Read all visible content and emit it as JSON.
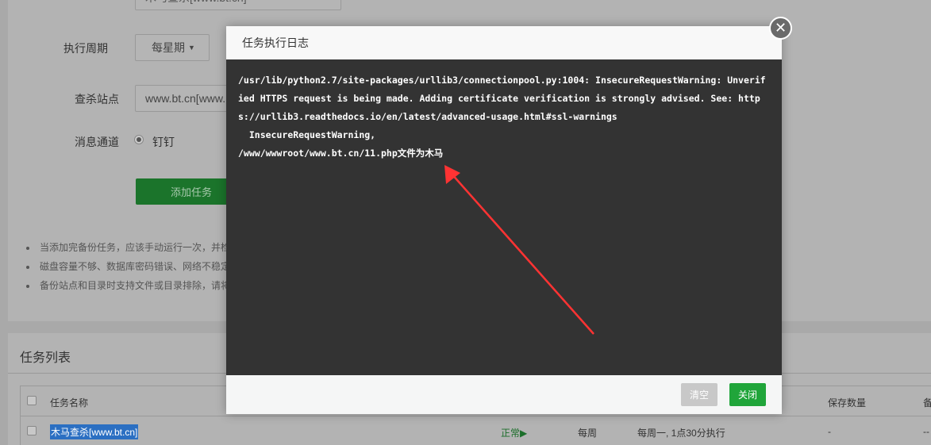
{
  "form": {
    "task_name_label": "任务名称",
    "task_name_value": "木马查杀[www.bt.cn]",
    "cycle_label": "执行周期",
    "cycle_value": "每星期",
    "site_label": "查杀站点",
    "site_value": "www.bt.cn[www.bt.cn]",
    "channel_label": "消息通道",
    "channel_option": "钉钉",
    "add_button": "添加任务",
    "tips": [
      "当添加完备份任务，应该手动运行一次，并检",
      "磁盘容量不够、数据库密码错误、网络不稳定",
      "备份站点和目录时支持文件或目录排除，请将"
    ]
  },
  "task_list": {
    "title": "任务列表",
    "headers": [
      "任务名称",
      "保存数量",
      "备"
    ],
    "rows": [
      {
        "name": "木马查杀[www.bt.cn]",
        "status": "正常",
        "cycle": "每周",
        "time": "每周一, 1点30分执行",
        "keep": "-",
        "extra": "--"
      }
    ]
  },
  "modal": {
    "title": "任务执行日志",
    "log": "/usr/lib/python2.7/site-packages/urllib3/connectionpool.py:1004: InsecureRequestWarning: Unverified HTTPS request is being made. Adding certificate verification is strongly advised. See: https://urllib3.readthedocs.io/en/latest/advanced-usage.html#ssl-warnings\n  InsecureRequestWarning,\n/www/wwwroot/www.bt.cn/11.php文件为木马",
    "clear_button": "清空",
    "close_button": "关闭"
  },
  "colors": {
    "accent": "#20a53a",
    "annotation_arrow": "#ff3333"
  }
}
